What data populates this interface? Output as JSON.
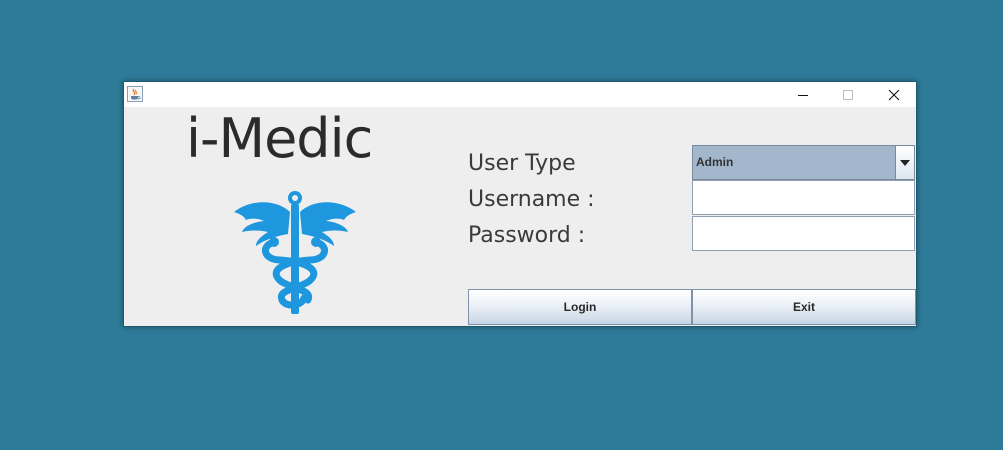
{
  "window": {
    "app_icon": "java-cup-icon",
    "controls": [
      "minimize-icon",
      "maximize-icon",
      "close-icon"
    ]
  },
  "logo": {
    "text": "i-Medic",
    "icon": "caduceus-icon",
    "icon_color": "#1f97de"
  },
  "form": {
    "user_type_label": "User Type",
    "user_type_value": "Admin",
    "username_label": "Username :",
    "username_value": "",
    "password_label": "Password :",
    "password_value": ""
  },
  "buttons": {
    "login_label": "Login",
    "exit_label": "Exit"
  },
  "colors": {
    "desktop": "#2e7b99",
    "select_bg": "#a3b7cc"
  }
}
